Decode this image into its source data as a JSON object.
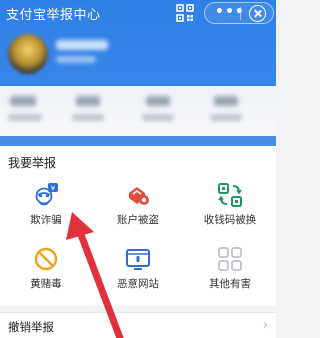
{
  "header": {
    "title": "支付宝举报中心",
    "more_label": "•••"
  },
  "report_section": {
    "title": "我要举报",
    "items": [
      {
        "label": "欺诈骗",
        "icon": "fraud-icon"
      },
      {
        "label": "账户被盗",
        "icon": "account-stolen-icon"
      },
      {
        "label": "收钱码被换",
        "icon": "qr-code-swapped-icon"
      },
      {
        "label": "黄赌毒",
        "icon": "prohibited-icon"
      },
      {
        "label": "恶意网站",
        "icon": "malicious-website-icon"
      },
      {
        "label": "其他有害",
        "icon": "other-harmful-icon"
      }
    ]
  },
  "cancel_report": {
    "label": "撤销举报",
    "chevron": "›"
  },
  "colors": {
    "header_blue": "#2f7fe6",
    "annotation_arrow": "#e0323c"
  }
}
